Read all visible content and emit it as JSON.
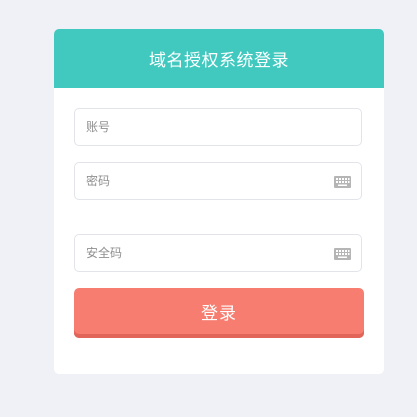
{
  "login": {
    "title": "域名授权系统登录",
    "account_placeholder": "账号",
    "password_placeholder": "密码",
    "security_code_placeholder": "安全码",
    "submit_label": "登录"
  },
  "icons": {
    "password_keyboard": "keyboard-icon",
    "security_code_keyboard": "keyboard-icon"
  },
  "colors": {
    "background": "#f0f1f6",
    "header": "#41c9bf",
    "button": "#f67d6f",
    "button_shadow": "#e2655a"
  }
}
